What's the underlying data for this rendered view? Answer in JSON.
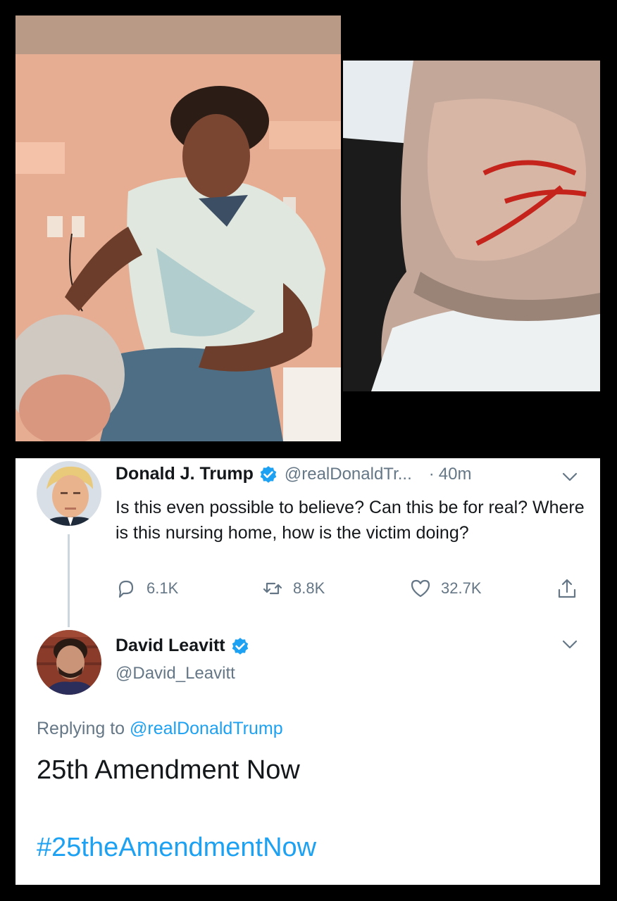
{
  "colors": {
    "link": "#1da1f2",
    "secondary_text": "#657786",
    "primary_text": "#14171a",
    "verified": "#1da1f2"
  },
  "photos": {
    "left_icon": "photo-assault-scene",
    "right_icon": "photo-injured-face"
  },
  "tweet": {
    "author_name": "Donald J. Trump",
    "author_handle": "@realDonaldTr...",
    "separator": "·",
    "time": "40m",
    "text": "Is this even possible to believe? Can this be for real? Where is this nursing home, how is the victim doing?",
    "actions": {
      "reply_icon": "reply-icon",
      "reply_count": "6.1K",
      "retweet_icon": "retweet-icon",
      "retweet_count": "8.8K",
      "like_icon": "heart-icon",
      "like_count": "32.7K",
      "share_icon": "share-icon"
    }
  },
  "reply": {
    "author_name": "David Leavitt",
    "author_handle": "@David_Leavitt",
    "replying_prefix": "Replying to",
    "replying_to": "@realDonaldTrump",
    "text": "25th Amendment Now",
    "hashtag": "#25theAmendmentNow"
  }
}
